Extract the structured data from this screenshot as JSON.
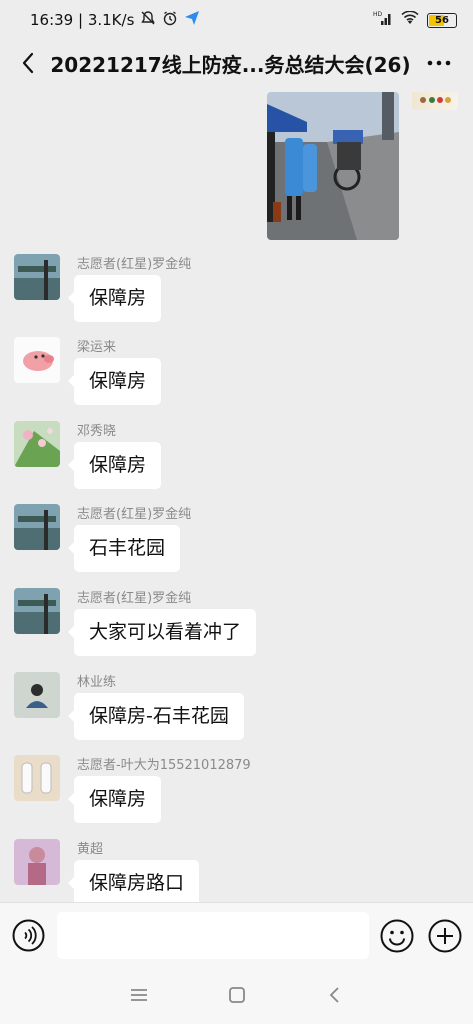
{
  "status_bar": {
    "time_speed": "16:39 | 3.1K/s",
    "battery": "56",
    "icons": [
      "mute-bell-icon",
      "alarm-icon",
      "send-arrow-icon",
      "hd-signal-icon",
      "wifi-icon",
      "battery-icon"
    ]
  },
  "header": {
    "title": "20221217线上防疫...务总结大会(26)",
    "back_icon": "chevron-left-icon",
    "more_icon": "more-dots-icon"
  },
  "messages": [
    {
      "sender": "志愿者(红星)罗金纯",
      "text": "保障房"
    },
    {
      "sender": "梁运来",
      "text": "保障房"
    },
    {
      "sender": "邓秀晓",
      "text": "保障房"
    },
    {
      "sender": "志愿者(红星)罗金纯",
      "text": "石丰花园"
    },
    {
      "sender": "志愿者(红星)罗金纯",
      "text": "大家可以看着冲了"
    },
    {
      "sender": "林业练",
      "text": "保障房-石丰花园"
    },
    {
      "sender": "志愿者-叶大为15521012879",
      "text": "保障房"
    },
    {
      "sender": "黄超",
      "text": "保障房路口"
    }
  ],
  "input_bar": {
    "value": "",
    "icons": [
      "voice-icon",
      "emoji-icon",
      "plus-icon"
    ]
  },
  "nav_bar": {
    "icons": [
      "menu-icon",
      "home-icon",
      "back-icon"
    ]
  }
}
